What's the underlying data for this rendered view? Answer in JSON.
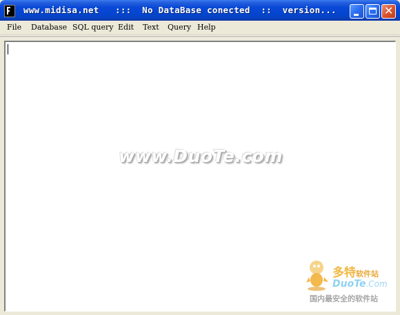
{
  "window": {
    "title": "www.midisa.net   :::  No DataBase conected  ::  version..."
  },
  "menubar": {
    "items": [
      "File",
      "Database",
      "SQL query",
      "Edit",
      "Text",
      "Query",
      "Help"
    ]
  },
  "editor": {
    "content": ""
  },
  "watermark": {
    "text": "www.DuoTe.com",
    "logo_cn": "多特",
    "logo_cn_suffix": "软件站",
    "logo_en": "DuoTe",
    "logo_en_suffix": ".Com",
    "logo_slogan": "国内最安全的软件站"
  },
  "colors": {
    "titlebar": "#0445cf",
    "menubar_bg": "#ece9d8",
    "editor_bg": "#ffffff",
    "close_button": "#d8512d"
  },
  "icons": {
    "app": "app-icon",
    "minimize": "minimize-icon",
    "maximize": "maximize-icon",
    "close": "close-icon"
  }
}
